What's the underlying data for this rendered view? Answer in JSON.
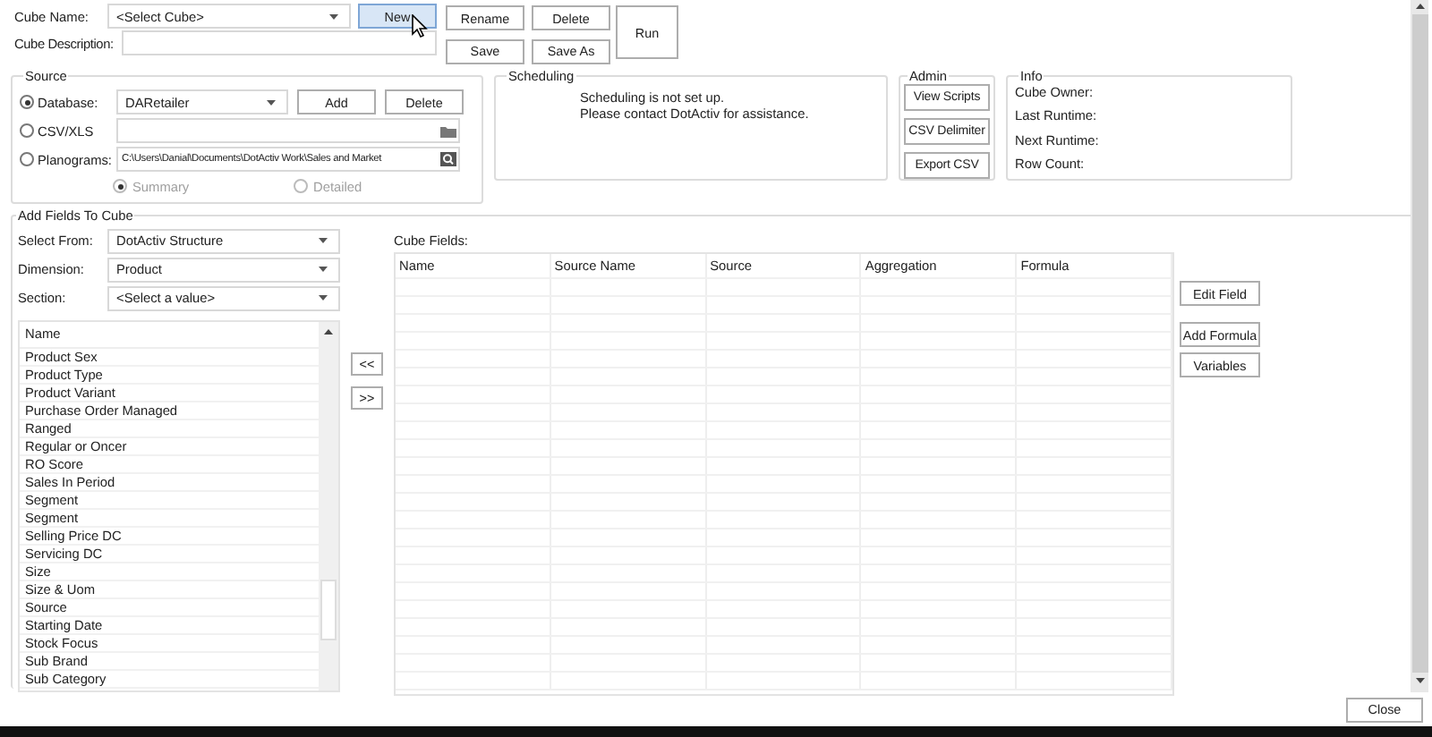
{
  "cube_name": {
    "label": "Cube Name:",
    "value": "<Select Cube>"
  },
  "cube_description": {
    "label": "Cube Description:"
  },
  "top_buttons": [
    {
      "label": "New",
      "highlighted": true
    },
    {
      "label": "Rename",
      "highlighted": false
    },
    {
      "label": "Delete",
      "highlighted": false
    },
    {
      "label": "Save",
      "highlighted": false
    },
    {
      "label": "Save As",
      "highlighted": false
    }
  ],
  "run_button": "Run",
  "source": {
    "title": "Source",
    "options": [
      {
        "label": "Database:",
        "selected": true,
        "kind": "dropdown",
        "value": "DARetailer"
      },
      {
        "label": "CSV/XLS",
        "selected": false,
        "kind": "file"
      },
      {
        "label": "Planograms:",
        "selected": false,
        "kind": "path",
        "value": "C:\\Users\\Danial\\Documents\\DotActiv Work\\Sales and Market"
      }
    ],
    "buttons": [
      "Add",
      "Delete"
    ],
    "modes": [
      {
        "label": "Summary",
        "selected": true,
        "disabled": true
      },
      {
        "label": "Detailed",
        "selected": false,
        "disabled": true
      }
    ]
  },
  "scheduling": {
    "title": "Scheduling",
    "message": [
      "Scheduling is not set up.",
      "Please contact DotActiv for assistance."
    ]
  },
  "admin": {
    "title": "Admin",
    "buttons": [
      "View Scripts",
      "CSV Delimiter",
      "Export CSV"
    ]
  },
  "info": {
    "title": "Info",
    "fields": [
      "Cube Owner:",
      "Last Runtime:",
      "Next Runtime:",
      "Row Count:"
    ]
  },
  "add_fields": {
    "title": "Add Fields To Cube",
    "filters": [
      {
        "label": "Select From:",
        "value": "DotActiv Structure"
      },
      {
        "label": "Dimension:",
        "value": "Product"
      },
      {
        "label": "Section:",
        "value": "<Select a value>"
      }
    ],
    "list_header": "Name",
    "items": [
      "Product Sex",
      "Product Type",
      "Product Variant",
      "Purchase Order Managed",
      "Ranged",
      "Regular or Oncer",
      "RO Score",
      "Sales In Period",
      "Segment",
      "Segment",
      "Selling Price DC",
      "Servicing DC",
      "Size",
      "Size & Uom",
      "Source",
      "Starting Date",
      "Stock Focus",
      "Sub Brand",
      "Sub Category"
    ],
    "move_buttons": [
      "<<",
      ">>"
    ]
  },
  "cube_fields": {
    "label": "Cube Fields:",
    "columns": [
      "Name",
      "Source Name",
      "Source",
      "Aggregation",
      "Formula"
    ],
    "buttons": [
      "Edit Field",
      "Add Formula",
      "Variables"
    ]
  },
  "close_button": "Close"
}
